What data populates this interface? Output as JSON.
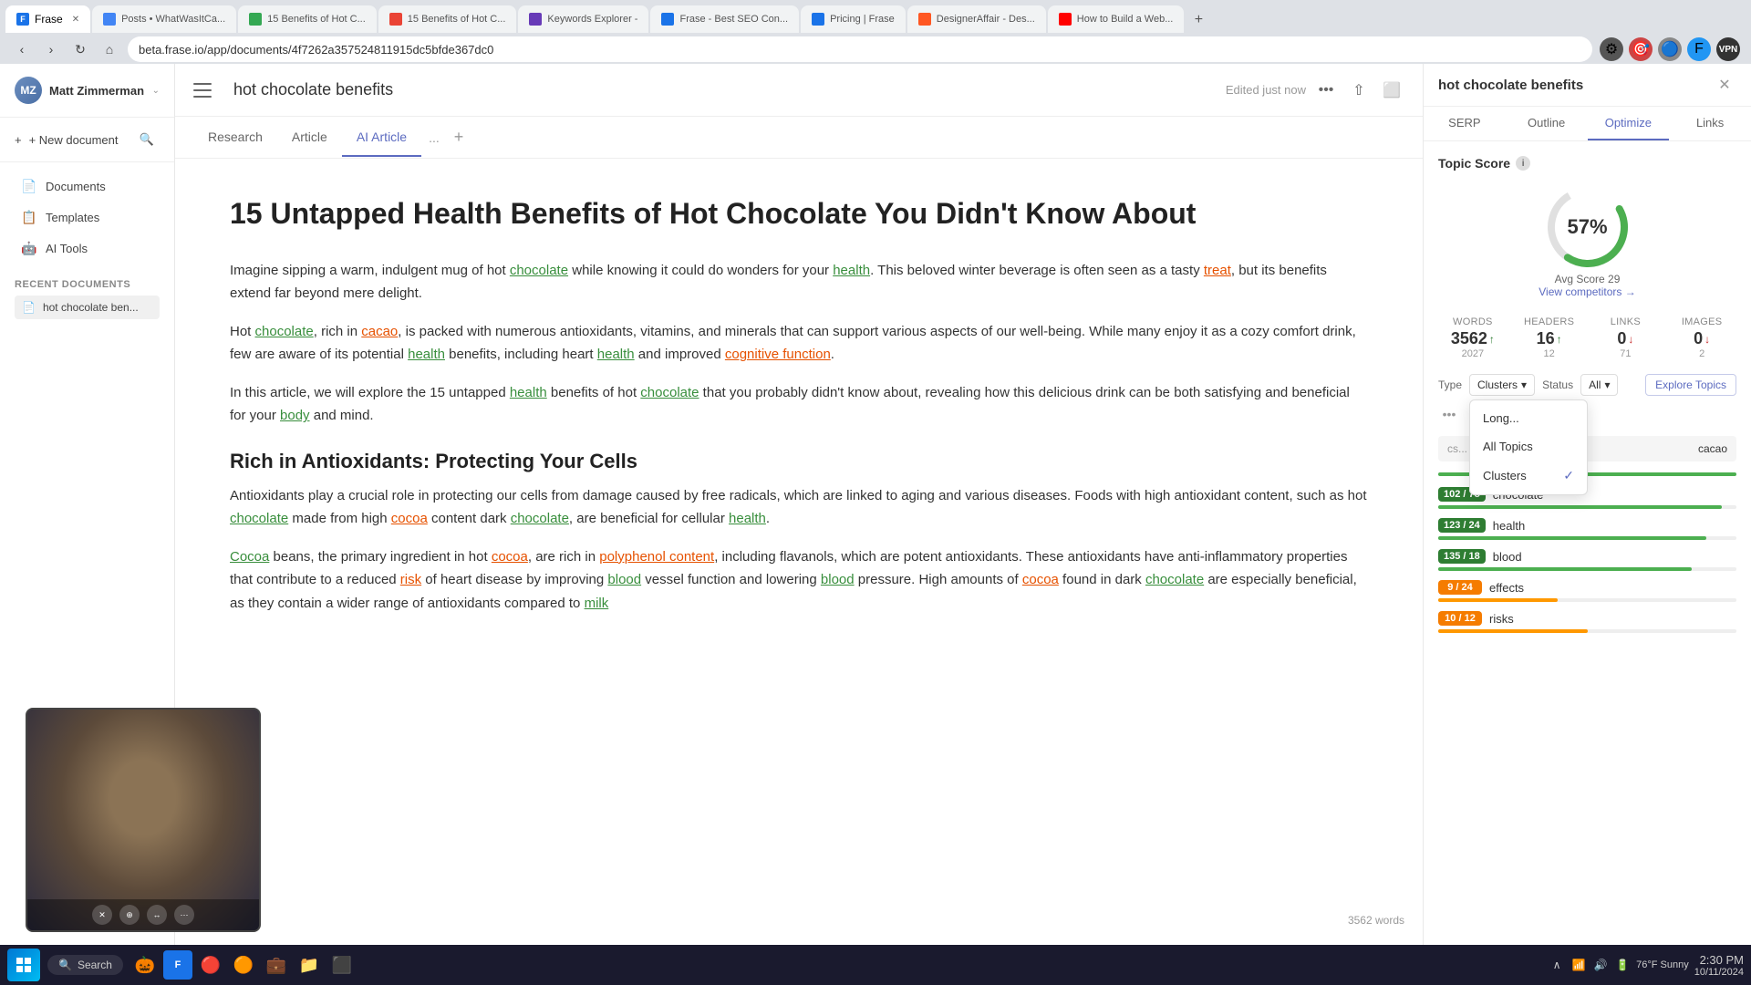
{
  "browser": {
    "url": "beta.frase.io/app/documents/4f7262a357524811915dc5bfde367dc0",
    "tabs": [
      {
        "label": "Frase",
        "active": true,
        "favicon": "F"
      },
      {
        "label": "Posts • WhatWasItCa...",
        "active": false
      },
      {
        "label": "15 Benefits of Hot C...",
        "active": false
      },
      {
        "label": "15 Benefits of Hot C...",
        "active": false
      },
      {
        "label": "Keywords Explorer -",
        "active": false
      },
      {
        "label": "Frase - Best SEO Con...",
        "active": false
      },
      {
        "label": "Pricing | Frase",
        "active": false
      },
      {
        "label": "DesignerAffair - Des...",
        "active": false
      },
      {
        "label": "How to Build a Web...",
        "active": false
      }
    ]
  },
  "sidebar": {
    "user": "Matt Zimmerman",
    "new_doc_label": "+ New document",
    "nav_items": [
      {
        "label": "Documents",
        "icon": "📄"
      },
      {
        "label": "Templates",
        "icon": "📋"
      },
      {
        "label": "AI Tools",
        "icon": "🤖"
      }
    ],
    "recent_label": "Recent documents",
    "recent_items": [
      {
        "label": "hot chocolate ben..."
      }
    ]
  },
  "doc_header": {
    "title": "hot chocolate benefits",
    "edited": "Edited just now",
    "tabs": [
      "Research",
      "Article",
      "AI Article"
    ],
    "more_tab": "...",
    "add_tab": "+"
  },
  "doc": {
    "title": "15 Untapped Health Benefits of Hot Chocolate You Didn't Know About",
    "paragraphs": [
      "Imagine sipping a warm, indulgent mug of hot chocolate while knowing it could do wonders for your health. This beloved winter beverage is often seen as a tasty treat, but its benefits extend far beyond mere delight.",
      "Hot chocolate, rich in cacao, is packed with numerous antioxidants, vitamins, and minerals that can support various aspects of our well-being. While many enjoy it as a cozy comfort drink, few are aware of its potential health benefits, including heart health and improved cognitive function.",
      "In this article, we will explore the 15 untapped health benefits of hot chocolate that you probably didn't know about, revealing how this delicious drink can be both satisfying and beneficial for your body and mind.",
      "Antioxidants play a crucial role in protecting our cells from damage caused by free radicals, which are linked to aging and various diseases. Foods with high antioxidant content, such as hot chocolate made from high cocoa content dark chocolate, are beneficial for cellular health.",
      "Cocoa beans, the primary ingredient in hot cocoa, are rich in polyphenol content, including flavanols, which are potent antioxidants. These antioxidants have anti-inflammatory properties that contribute to a reduced risk of heart disease by improving blood vessel function and lowering blood pressure. High amounts of cocoa found in dark chocolate are especially beneficial, as they contain a wider range of antioxidants compared to milk"
    ],
    "h2": "Rich in Antioxidants: Protecting Your Cells",
    "word_count": "3562 words"
  },
  "right_panel": {
    "title": "hot chocolate benefits",
    "tabs": [
      "SERP",
      "Outline",
      "Optimize",
      "Links"
    ],
    "active_tab": "Optimize",
    "topic_score_label": "Topic Score",
    "score_value": "57%",
    "avg_score_label": "Avg Score 29",
    "view_competitors": "View competitors →",
    "stats": {
      "words": {
        "label": "WORDS",
        "value": "3562",
        "trend": "up",
        "sub": "2027"
      },
      "headers": {
        "label": "HEADERS",
        "value": "16",
        "trend": "up",
        "sub": "12"
      },
      "links": {
        "label": "LINKS",
        "value": "0",
        "trend": "down",
        "sub": "71"
      },
      "images": {
        "label": "IMAGES",
        "value": "0",
        "trend": "down",
        "sub": "2"
      }
    },
    "type_label": "Type",
    "type_value": "Clusters",
    "status_label": "Status",
    "status_value": "All",
    "explore_btn": "Explore Topics",
    "dropdown": {
      "items": [
        {
          "label": "Long...",
          "checked": false
        },
        {
          "label": "All Topics",
          "checked": false
        },
        {
          "label": "Clusters",
          "checked": true
        }
      ]
    },
    "topic_items": [
      {
        "score": "102 / 78",
        "name": "chocolate",
        "fill_pct": 95,
        "type": "green"
      },
      {
        "score": "123 / 24",
        "name": "health",
        "fill_pct": 90,
        "type": "green"
      },
      {
        "score": "135 / 18",
        "name": "blood",
        "fill_pct": 85,
        "type": "green"
      },
      {
        "score": "9 / 24",
        "name": "effects",
        "fill_pct": 40,
        "type": "yellow"
      },
      {
        "score": "10 / 12",
        "name": "risks",
        "fill_pct": 50,
        "type": "yellow"
      }
    ]
  },
  "taskbar": {
    "search_placeholder": "Search",
    "time": "2:30 PM",
    "date": "10/11/2024",
    "weather": "76°F Sunny"
  }
}
